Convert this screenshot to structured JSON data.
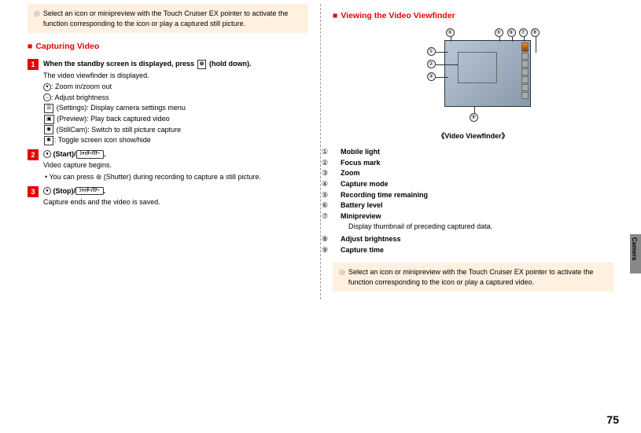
{
  "left": {
    "tip": "Select an icon or minipreview with the Touch Cruiser EX pointer to activate the function corresponding to the icon or play a captured still picture.",
    "heading": "Capturing Video",
    "steps": [
      {
        "num": "1",
        "title_before": "When the standby screen is displayed, press ",
        "title_icon": "⊚",
        "title_after": " (hold down).",
        "desc": "The video viewfinder is displayed.",
        "icons": [
          {
            "glyph": "✦",
            "label": ": Zoom in/zoom out"
          },
          {
            "glyph": "↔",
            "label": ": Adjust brightness"
          },
          {
            "glyph": "☰",
            "label": " (Settings): Display camera settings menu"
          },
          {
            "glyph": "▣",
            "label": " (Preview): Play back captured video"
          },
          {
            "glyph": "◉",
            "label": " (StillCam): Switch to still picture capture"
          },
          {
            "glyph": "✱",
            "label": ": Toggle screen icon show/hide"
          }
        ]
      },
      {
        "num": "2",
        "title_before": "",
        "title_mid": " (Start)/",
        "title_btn": "ｼｬｯﾀｰ/ﾏﾅｰ",
        "title_after": ".",
        "desc": "Video capture begins.",
        "bullet": "You can press ⊚ (Shutter) during recording to capture a still picture."
      },
      {
        "num": "3",
        "title_before": "",
        "title_mid": " (Stop)/",
        "title_btn": "ｼｬｯﾀｰ/ﾏﾅｰ",
        "title_after": ".",
        "desc": "Capture ends and the video is saved."
      }
    ]
  },
  "right": {
    "heading": "Viewing the Video Viewfinder",
    "caption": "《Video Viewfinder》",
    "legend": [
      {
        "n": "①",
        "label": "Mobile light"
      },
      {
        "n": "②",
        "label": "Focus mark"
      },
      {
        "n": "③",
        "label": "Zoom"
      },
      {
        "n": "④",
        "label": "Capture mode"
      },
      {
        "n": "⑤",
        "label": "Recording time remaining"
      },
      {
        "n": "⑥",
        "label": "Battery level"
      },
      {
        "n": "⑦",
        "label": "Minipreview",
        "desc": "Display thumbnail of preceding captured data."
      },
      {
        "n": "⑧",
        "label": "Adjust brightness"
      },
      {
        "n": "⑨",
        "label": "Capture time"
      }
    ],
    "tip": "Select an icon or minipreview with the Touch Cruiser EX pointer to activate the function corresponding to the icon or play a captured video."
  },
  "tab": "Camera",
  "pageNum": "75",
  "callouts": {
    "c1": "①",
    "c2": "②",
    "c3": "③",
    "c4": "④",
    "c5": "⑤",
    "c6": "⑥",
    "c7": "⑦",
    "c8": "⑧",
    "c9": "⑨"
  }
}
